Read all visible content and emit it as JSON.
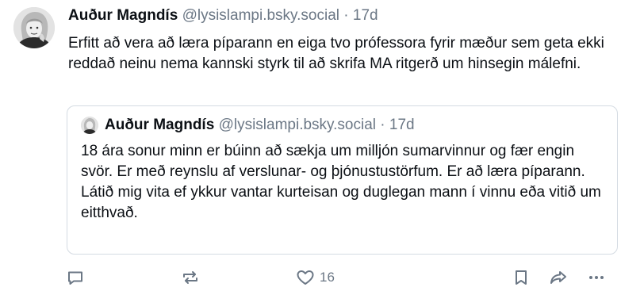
{
  "post": {
    "author": "Auður Magndís",
    "handle": "@lysislampi.bsky.social",
    "separator": "·",
    "time": "17d",
    "text": "Erfitt að vera að læra píparann en eiga tvo prófessora fyrir mæður sem geta ekki reddað neinu nema kannski styrk til að skrifa MA ritgerð um hinsegin málefni."
  },
  "quote": {
    "author": "Auður Magndís",
    "handle": "@lysislampi.bsky.social",
    "separator": "·",
    "time": "17d",
    "paragraphs": [
      "18 ára sonur minn er búinn að sækja um milljón sumarvinnur og fær engin svör. Er með reynslu af verslunar- og þjónustustörfum. Er að læra píparann.",
      "Látið mig vita ef ykkur vantar kurteisan og duglegan mann í vinnu eða vitið um eitthvað."
    ]
  },
  "actions": {
    "like_count": "16",
    "icons": [
      "reply-icon",
      "repost-icon",
      "like-icon",
      "bookmark-icon",
      "share-icon",
      "more-icon"
    ]
  }
}
